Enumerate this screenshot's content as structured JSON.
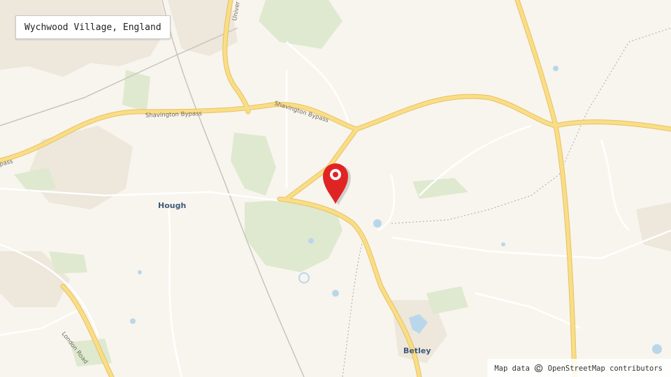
{
  "location_label": "Wychwood Village, England",
  "attribution": "Map data ©️ OpenStreetMap contributors",
  "places": {
    "hough": "Hough",
    "betley": "Betley"
  },
  "roads": {
    "shavington_bypass_west": "Shavington Bypass",
    "shavington_bypass_east": "Shavington Bypass",
    "bypass_fragment": "pass",
    "london_road": "London Road",
    "university_fragment": "Univer"
  },
  "marker": {
    "name": "location-marker-icon",
    "color": "#e02424"
  },
  "colors": {
    "background": "#f8f5ee",
    "major_road": "#f7d774",
    "minor_road": "#ffffff",
    "woodland": "#dfe9cf",
    "water": "#b9d7ea",
    "urban": "#ece6dc"
  }
}
